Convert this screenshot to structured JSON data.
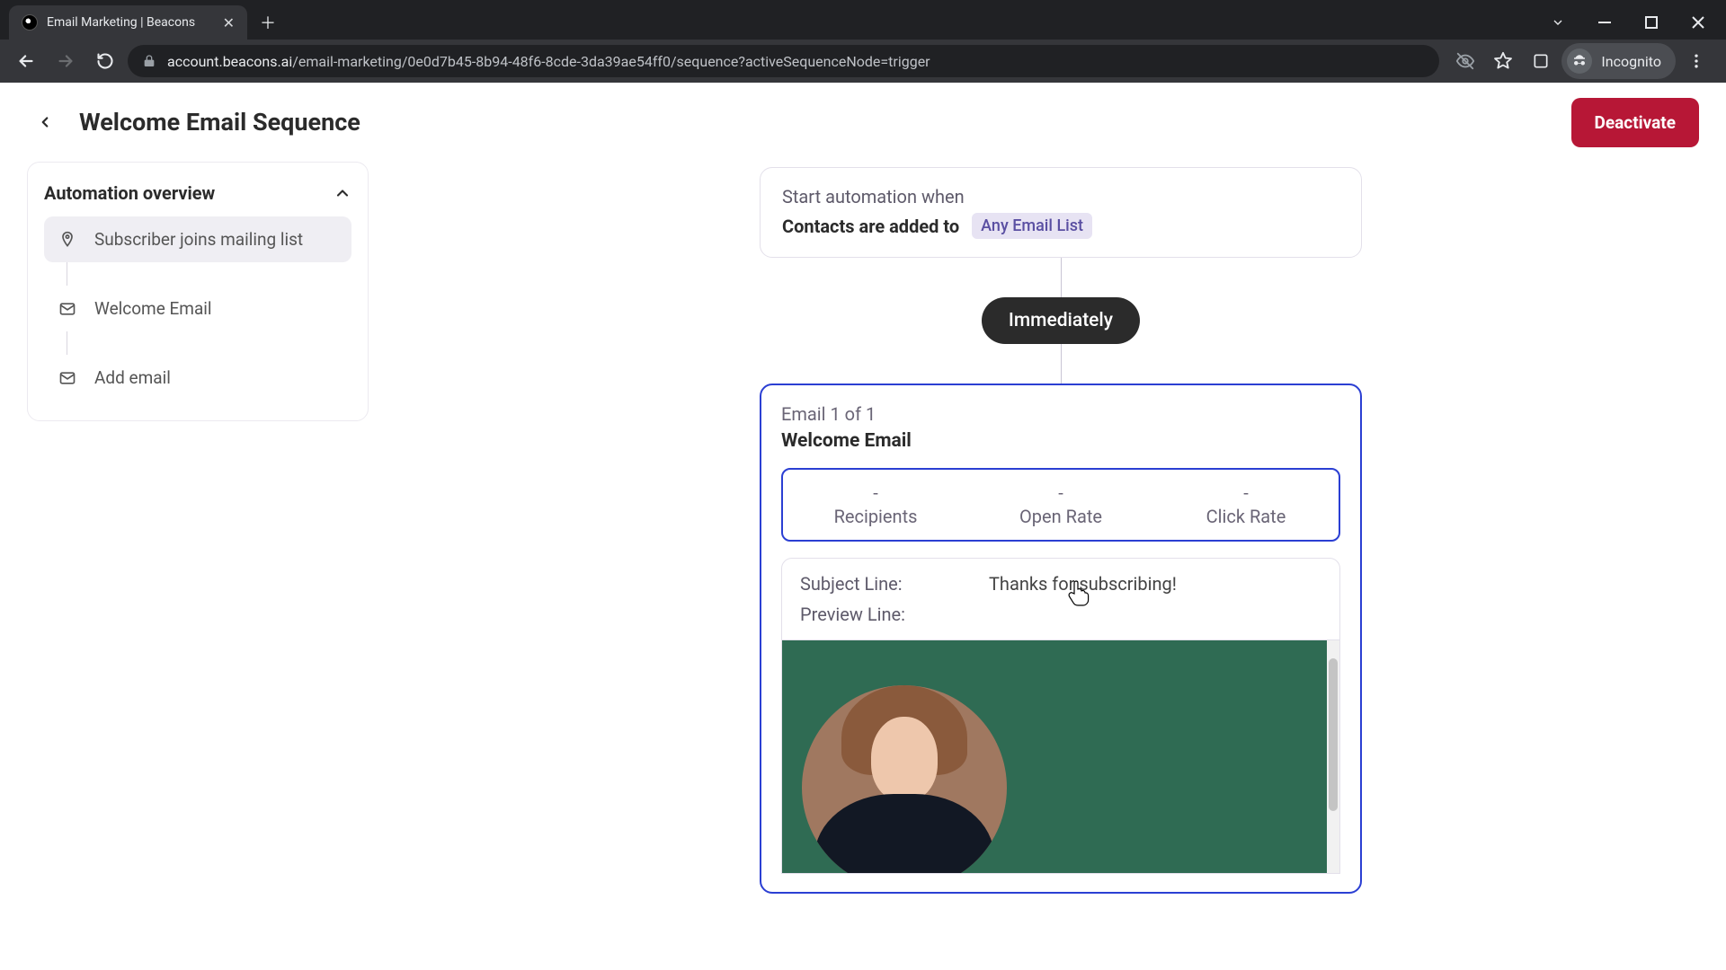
{
  "browser": {
    "tab_title": "Email Marketing | Beacons",
    "url_host": "account.beacons.ai",
    "url_path": "/email-marketing/0e0d7b45-8b94-48f6-8cde-3da39ae54ff0/sequence?activeSequenceNode=trigger",
    "incognito_label": "Incognito"
  },
  "header": {
    "title": "Welcome Email Sequence",
    "deactivate_label": "Deactivate"
  },
  "sidebar": {
    "title": "Automation overview",
    "items": [
      {
        "label": "Subscriber joins mailing list"
      },
      {
        "label": "Welcome Email"
      },
      {
        "label": "Add email"
      }
    ]
  },
  "trigger": {
    "line1": "Start automation when",
    "line2_prefix": "Contacts are added to",
    "chip": "Any Email List"
  },
  "timing_pill": "Immediately",
  "email": {
    "meta": "Email 1 of 1",
    "title": "Welcome Email",
    "stats": [
      {
        "value": "-",
        "label": "Recipients"
      },
      {
        "value": "-",
        "label": "Open Rate"
      },
      {
        "value": "-",
        "label": "Click Rate"
      }
    ],
    "subject_key": "Subject Line:",
    "subject_val": "Thanks for subscribing!",
    "preview_key": "Preview Line:",
    "preview_val": ""
  }
}
